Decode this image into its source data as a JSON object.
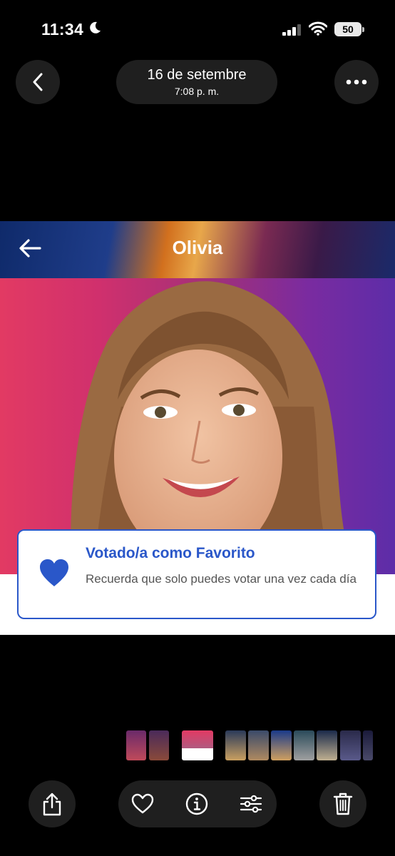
{
  "status_bar": {
    "time": "11:34",
    "battery": "50"
  },
  "top_nav": {
    "date": "16 de setembre",
    "time": "7:08 p. m."
  },
  "photo": {
    "screen_title": "Olivia",
    "vote_card": {
      "title": "Votado/a como Favorito",
      "message": "Recuerda que solo puedes votar una vez cada día"
    }
  },
  "colors": {
    "accent": "#2a57c9",
    "toolbar": "#1f1f1f"
  },
  "icons": [
    "back-chevron-icon",
    "more-icon",
    "share-icon",
    "heart-outline-icon",
    "info-icon",
    "adjustments-icon",
    "trash-icon",
    "heart-filled-icon"
  ]
}
